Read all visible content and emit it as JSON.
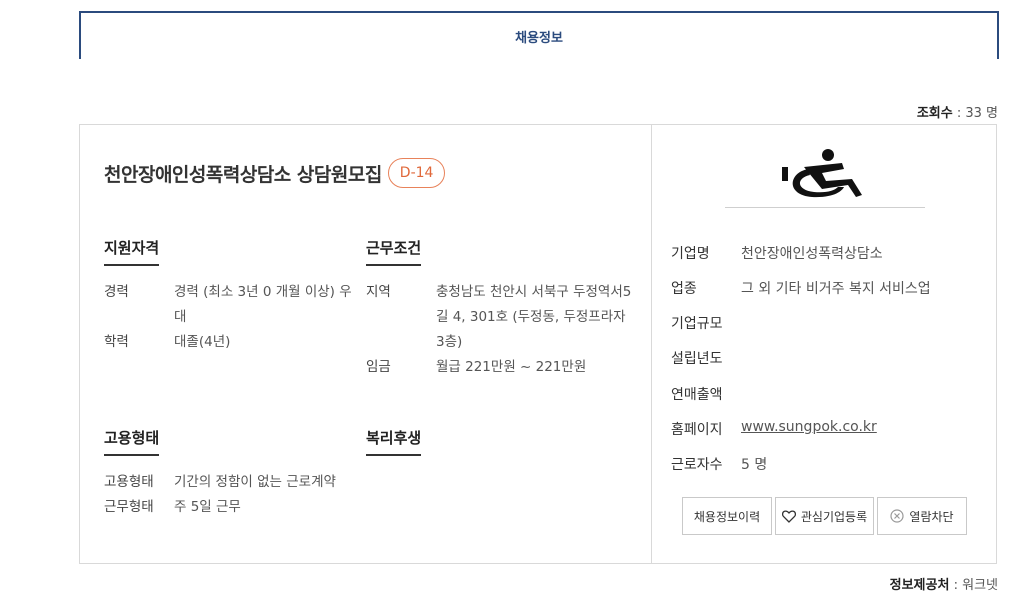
{
  "tab": {
    "label": "채용정보"
  },
  "views": {
    "label": "조회수",
    "sep": " : ",
    "value": "33 명"
  },
  "job": {
    "title": "천안장애인성폭력상담소 상담원모집",
    "dday": "D-14"
  },
  "qualification": {
    "heading": "지원자격",
    "rows": [
      {
        "key": "경력",
        "value": "경력 (최소 3년 0 개월 이상) 우대"
      },
      {
        "key": "학력",
        "value": "대졸(4년)"
      }
    ]
  },
  "conditions": {
    "heading": "근무조건",
    "rows": [
      {
        "key": "지역",
        "value": "충청남도 천안시 서북구 두정역서5길 4, 301호 (두정동, 두정프라자 3층)"
      },
      {
        "key": "임금",
        "value": "월급 221만원 ~ 221만원"
      }
    ]
  },
  "employment": {
    "heading": "고용형태",
    "rows": [
      {
        "key": "고용형태",
        "value": "기간의 정함이 없는 근로계약"
      },
      {
        "key": "근무형태",
        "value": "주 5일 근무"
      }
    ]
  },
  "welfare": {
    "heading": "복리후생"
  },
  "company": {
    "logo_icon": "wheelchair-icon",
    "rows": [
      {
        "key": "기업명",
        "value": "천안장애인성폭력상담소"
      },
      {
        "key": "업종",
        "value": "그 외 기타 비거주 복지 서비스업"
      },
      {
        "key": "기업규모",
        "value": ""
      },
      {
        "key": "설립년도",
        "value": ""
      },
      {
        "key": "연매출액",
        "value": ""
      },
      {
        "key": "홈페이지",
        "value": "www.sungpok.co.kr"
      },
      {
        "key": "근로자수",
        "value": "5 명"
      }
    ]
  },
  "buttons": {
    "history": "채용정보이력",
    "favorite": "관심기업등록",
    "block": "열람차단"
  },
  "source": {
    "label": "정보제공처",
    "sep": " : ",
    "value": "워크넷"
  }
}
